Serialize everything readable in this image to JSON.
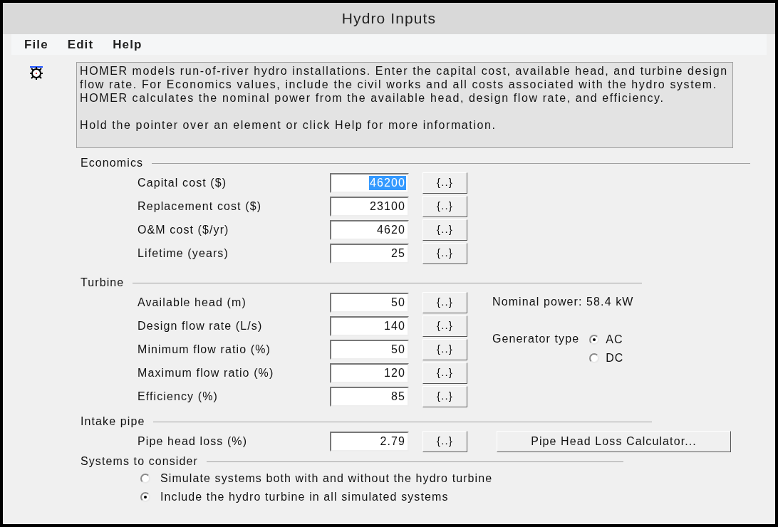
{
  "window": {
    "title": "Hydro Inputs"
  },
  "menu": [
    {
      "label": "File"
    },
    {
      "label": "Edit"
    },
    {
      "label": "Help"
    }
  ],
  "description": {
    "paragraphs": [
      "HOMER models run-of-river hydro installations. Enter the capital cost, available head, and turbine design flow rate.  For Economics values, include the civil works and all costs associated with the hydro system. HOMER calculates the nominal power from the available head, design flow rate, and efficiency.",
      "Hold the pointer over an element or click Help for more information."
    ]
  },
  "economics": {
    "title": "Economics",
    "fields": [
      {
        "label": "Capital  cost ($)",
        "value": "46200",
        "highlighted": true,
        "button": "{..}"
      },
      {
        "label": "Replacement cost ($)",
        "value": "23100",
        "highlighted": false,
        "button": "{..}"
      },
      {
        "label": "O&M cost ($/yr)",
        "value": "4620",
        "highlighted": false,
        "button": "{..}"
      },
      {
        "label": "Lifetime (years)",
        "value": "25",
        "highlighted": false,
        "button": "{..}"
      }
    ]
  },
  "turbine": {
    "title": "Turbine",
    "fields": [
      {
        "label": "Available head (m)",
        "value": "50",
        "highlighted": false,
        "button": "{..}"
      },
      {
        "label": "Design flow rate (L/s)",
        "value": "140",
        "highlighted": false,
        "button": "{..}"
      },
      {
        "label": "Minimum flow ratio (%)",
        "value": "50",
        "highlighted": false,
        "button": "{..}"
      },
      {
        "label": "Maximum flow ratio (%)",
        "value": "120",
        "highlighted": false,
        "button": "{..}"
      },
      {
        "label": "Efficiency (%)",
        "value": "85",
        "highlighted": false,
        "button": "{..}"
      }
    ],
    "nominal_power": "Nominal power: 58.4 kW",
    "generator_type": {
      "label": "Generator type",
      "options": [
        {
          "label": "AC",
          "selected": true
        },
        {
          "label": "DC",
          "selected": false
        }
      ]
    }
  },
  "intake_pipe": {
    "title": "Intake pipe",
    "fields": [
      {
        "label": "Pipe head loss (%)",
        "value": "2.79",
        "highlighted": false,
        "button": "{..}"
      }
    ],
    "calculator_button": "Pipe Head Loss Calculator..."
  },
  "systems": {
    "title": "Systems to consider",
    "options": [
      {
        "label": "Simulate systems both with and without the hydro turbine",
        "selected": false
      },
      {
        "label": "Include the hydro turbine in all simulated systems",
        "selected": true
      }
    ]
  }
}
